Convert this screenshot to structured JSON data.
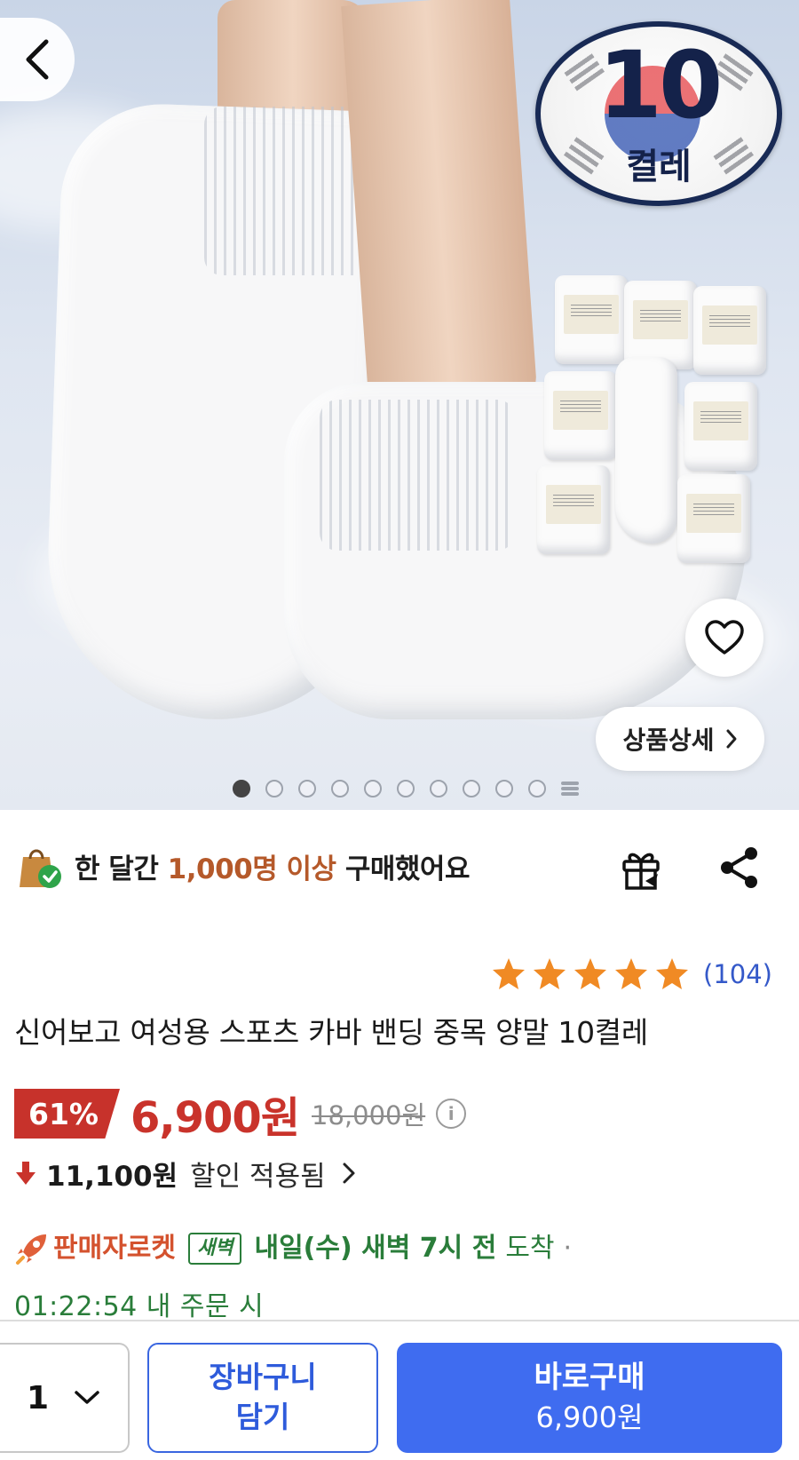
{
  "hero": {
    "badge_number": "10",
    "badge_unit": "켤레",
    "detail_button_label": "상품상세",
    "image_count": 10,
    "active_image_index": 0
  },
  "social_proof": {
    "prefix": "한 달간 ",
    "highlight": "1,000명 이상",
    "suffix": " 구매했어요"
  },
  "rating": {
    "stars": 5,
    "count": "(104)"
  },
  "product": {
    "title": "신어보고 여성용 스포츠 카바 밴딩 중목 양말 10켤레"
  },
  "price": {
    "discount": "61%",
    "sale_price": "6,900원",
    "original_price": "18,000원",
    "info_icon": "i"
  },
  "coupon": {
    "amount": "11,100원",
    "text": "할인 적용됨"
  },
  "delivery": {
    "seller_rocket": "판매자로켓",
    "badge": "새벽",
    "eta": "내일(수) 새벽 7시 전",
    "arrive": "도착",
    "separator": "·",
    "countdown": "01:22:54 내 주문 시"
  },
  "bottom_bar": {
    "quantity": "1",
    "cart_line1": "장바구니",
    "cart_line2": "담기",
    "buy_label": "바로구매",
    "buy_price": "6,900원"
  },
  "colors": {
    "accent_blue": "#3f6cf0",
    "sale_red": "#c9332b",
    "delivery_green": "#2a7d3a",
    "star_orange": "#f08a24",
    "social_highlight": "#b5592a"
  },
  "icons": [
    "back-arrow-icon",
    "heart-icon",
    "chevron-right-icon",
    "shopping-bag-icon",
    "gift-icon",
    "share-icon",
    "star-icon",
    "info-icon",
    "down-arrow-icon",
    "rocket-icon",
    "chevron-down-icon"
  ]
}
